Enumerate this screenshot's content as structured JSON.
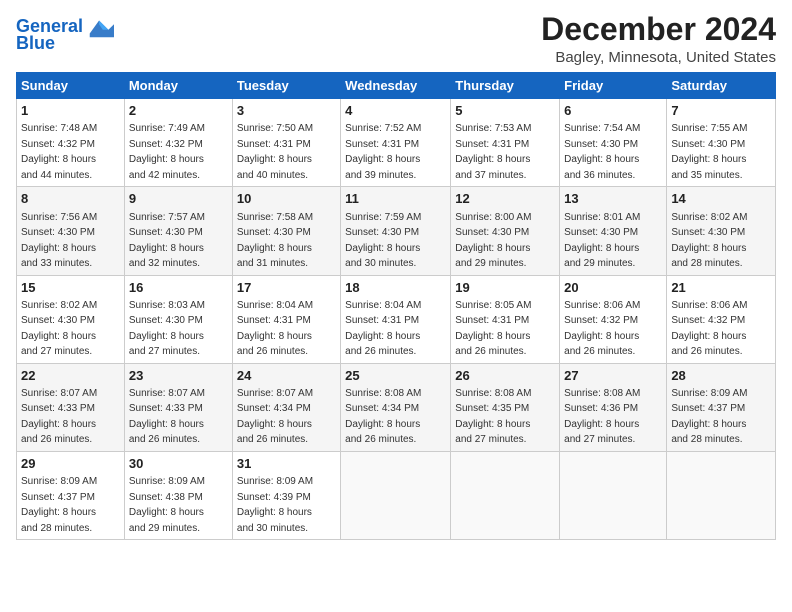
{
  "logo": {
    "line1": "General",
    "line2": "Blue"
  },
  "title": "December 2024",
  "subtitle": "Bagley, Minnesota, United States",
  "days_header": [
    "Sunday",
    "Monday",
    "Tuesday",
    "Wednesday",
    "Thursday",
    "Friday",
    "Saturday"
  ],
  "weeks": [
    [
      {
        "day": "1",
        "info": "Sunrise: 7:48 AM\nSunset: 4:32 PM\nDaylight: 8 hours\nand 44 minutes."
      },
      {
        "day": "2",
        "info": "Sunrise: 7:49 AM\nSunset: 4:32 PM\nDaylight: 8 hours\nand 42 minutes."
      },
      {
        "day": "3",
        "info": "Sunrise: 7:50 AM\nSunset: 4:31 PM\nDaylight: 8 hours\nand 40 minutes."
      },
      {
        "day": "4",
        "info": "Sunrise: 7:52 AM\nSunset: 4:31 PM\nDaylight: 8 hours\nand 39 minutes."
      },
      {
        "day": "5",
        "info": "Sunrise: 7:53 AM\nSunset: 4:31 PM\nDaylight: 8 hours\nand 37 minutes."
      },
      {
        "day": "6",
        "info": "Sunrise: 7:54 AM\nSunset: 4:30 PM\nDaylight: 8 hours\nand 36 minutes."
      },
      {
        "day": "7",
        "info": "Sunrise: 7:55 AM\nSunset: 4:30 PM\nDaylight: 8 hours\nand 35 minutes."
      }
    ],
    [
      {
        "day": "8",
        "info": "Sunrise: 7:56 AM\nSunset: 4:30 PM\nDaylight: 8 hours\nand 33 minutes."
      },
      {
        "day": "9",
        "info": "Sunrise: 7:57 AM\nSunset: 4:30 PM\nDaylight: 8 hours\nand 32 minutes."
      },
      {
        "day": "10",
        "info": "Sunrise: 7:58 AM\nSunset: 4:30 PM\nDaylight: 8 hours\nand 31 minutes."
      },
      {
        "day": "11",
        "info": "Sunrise: 7:59 AM\nSunset: 4:30 PM\nDaylight: 8 hours\nand 30 minutes."
      },
      {
        "day": "12",
        "info": "Sunrise: 8:00 AM\nSunset: 4:30 PM\nDaylight: 8 hours\nand 29 minutes."
      },
      {
        "day": "13",
        "info": "Sunrise: 8:01 AM\nSunset: 4:30 PM\nDaylight: 8 hours\nand 29 minutes."
      },
      {
        "day": "14",
        "info": "Sunrise: 8:02 AM\nSunset: 4:30 PM\nDaylight: 8 hours\nand 28 minutes."
      }
    ],
    [
      {
        "day": "15",
        "info": "Sunrise: 8:02 AM\nSunset: 4:30 PM\nDaylight: 8 hours\nand 27 minutes."
      },
      {
        "day": "16",
        "info": "Sunrise: 8:03 AM\nSunset: 4:30 PM\nDaylight: 8 hours\nand 27 minutes."
      },
      {
        "day": "17",
        "info": "Sunrise: 8:04 AM\nSunset: 4:31 PM\nDaylight: 8 hours\nand 26 minutes."
      },
      {
        "day": "18",
        "info": "Sunrise: 8:04 AM\nSunset: 4:31 PM\nDaylight: 8 hours\nand 26 minutes."
      },
      {
        "day": "19",
        "info": "Sunrise: 8:05 AM\nSunset: 4:31 PM\nDaylight: 8 hours\nand 26 minutes."
      },
      {
        "day": "20",
        "info": "Sunrise: 8:06 AM\nSunset: 4:32 PM\nDaylight: 8 hours\nand 26 minutes."
      },
      {
        "day": "21",
        "info": "Sunrise: 8:06 AM\nSunset: 4:32 PM\nDaylight: 8 hours\nand 26 minutes."
      }
    ],
    [
      {
        "day": "22",
        "info": "Sunrise: 8:07 AM\nSunset: 4:33 PM\nDaylight: 8 hours\nand 26 minutes."
      },
      {
        "day": "23",
        "info": "Sunrise: 8:07 AM\nSunset: 4:33 PM\nDaylight: 8 hours\nand 26 minutes."
      },
      {
        "day": "24",
        "info": "Sunrise: 8:07 AM\nSunset: 4:34 PM\nDaylight: 8 hours\nand 26 minutes."
      },
      {
        "day": "25",
        "info": "Sunrise: 8:08 AM\nSunset: 4:34 PM\nDaylight: 8 hours\nand 26 minutes."
      },
      {
        "day": "26",
        "info": "Sunrise: 8:08 AM\nSunset: 4:35 PM\nDaylight: 8 hours\nand 27 minutes."
      },
      {
        "day": "27",
        "info": "Sunrise: 8:08 AM\nSunset: 4:36 PM\nDaylight: 8 hours\nand 27 minutes."
      },
      {
        "day": "28",
        "info": "Sunrise: 8:09 AM\nSunset: 4:37 PM\nDaylight: 8 hours\nand 28 minutes."
      }
    ],
    [
      {
        "day": "29",
        "info": "Sunrise: 8:09 AM\nSunset: 4:37 PM\nDaylight: 8 hours\nand 28 minutes."
      },
      {
        "day": "30",
        "info": "Sunrise: 8:09 AM\nSunset: 4:38 PM\nDaylight: 8 hours\nand 29 minutes."
      },
      {
        "day": "31",
        "info": "Sunrise: 8:09 AM\nSunset: 4:39 PM\nDaylight: 8 hours\nand 30 minutes."
      },
      {
        "day": "",
        "info": ""
      },
      {
        "day": "",
        "info": ""
      },
      {
        "day": "",
        "info": ""
      },
      {
        "day": "",
        "info": ""
      }
    ]
  ]
}
